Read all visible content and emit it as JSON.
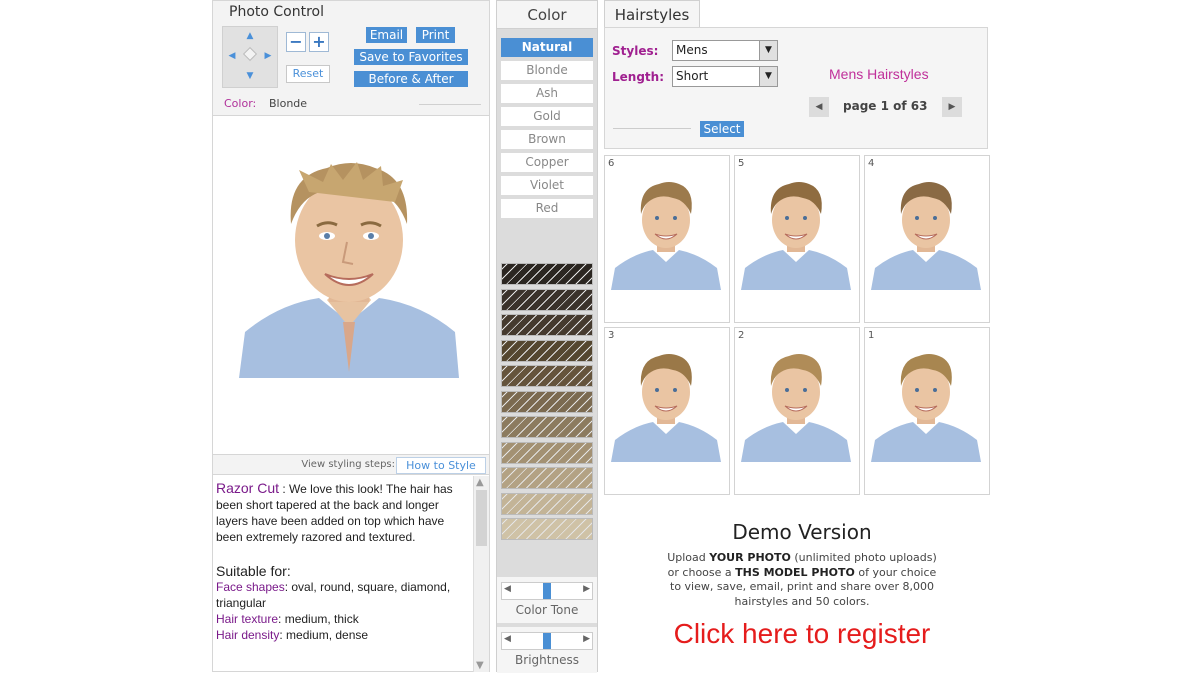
{
  "photo_control": {
    "title": "Photo Control",
    "minus": "−",
    "plus": "+",
    "reset": "Reset",
    "email": "Email",
    "print": "Print",
    "save_favorites": "Save to Favorites",
    "before_after": "Before & After",
    "color_label": "Color:",
    "color_value": "Blonde"
  },
  "styling": {
    "steps_label": "View styling steps:",
    "how_to_style": "How to Style"
  },
  "description": {
    "style_name": "Razor Cut",
    "text": " : We love this look! The hair has been short tapered at the back and longer layers have been added on top which have been extremely razored and textured.",
    "suitable_for": "Suitable for:",
    "face_label": "Face shapes",
    "face_value": ": oval, round, square, diamond, triangular",
    "texture_label": "Hair texture",
    "texture_value": ": medium, thick",
    "density_label": "Hair density",
    "density_value": ": medium, dense"
  },
  "color_panel": {
    "title": "Color",
    "options": [
      "Natural",
      "Blonde",
      "Ash",
      "Gold",
      "Brown",
      "Copper",
      "Violet",
      "Red"
    ],
    "selected": "Natural",
    "swatches": [
      "#2b2621",
      "#3a312a",
      "#453a2e",
      "#54462f",
      "#65543c",
      "#7b6a50",
      "#8c7b5f",
      "#a39173",
      "#b3a284",
      "#c3b497",
      "#cfc2a6"
    ],
    "color_tone_label": "Color Tone",
    "brightness_label": "Brightness",
    "color_tone_level": 0.5,
    "brightness_level": 0.5
  },
  "hairstyles": {
    "tab": "Hairstyles",
    "styles_label": "Styles:",
    "styles_value": "Mens",
    "length_label": "Length:",
    "length_value": "Short",
    "section_title": "Mens Hairstyles",
    "page_info": "page 1 of 63",
    "select_button": "Select",
    "thumbnails": [
      "6",
      "5",
      "4",
      "3",
      "2",
      "1"
    ]
  },
  "demo": {
    "title": "Demo Version",
    "line1_pre": "Upload ",
    "line1_bold": "YOUR PHOTO",
    "line1_post": " (unlimited photo uploads)",
    "line2_pre": "or choose a ",
    "line2_bold": "THS MODEL PHOTO",
    "line2_post": " of your choice",
    "line3": "to view, save, email, print and share over 8,000",
    "line4": "hairstyles and 50 colors.",
    "register": "Click here to register"
  }
}
